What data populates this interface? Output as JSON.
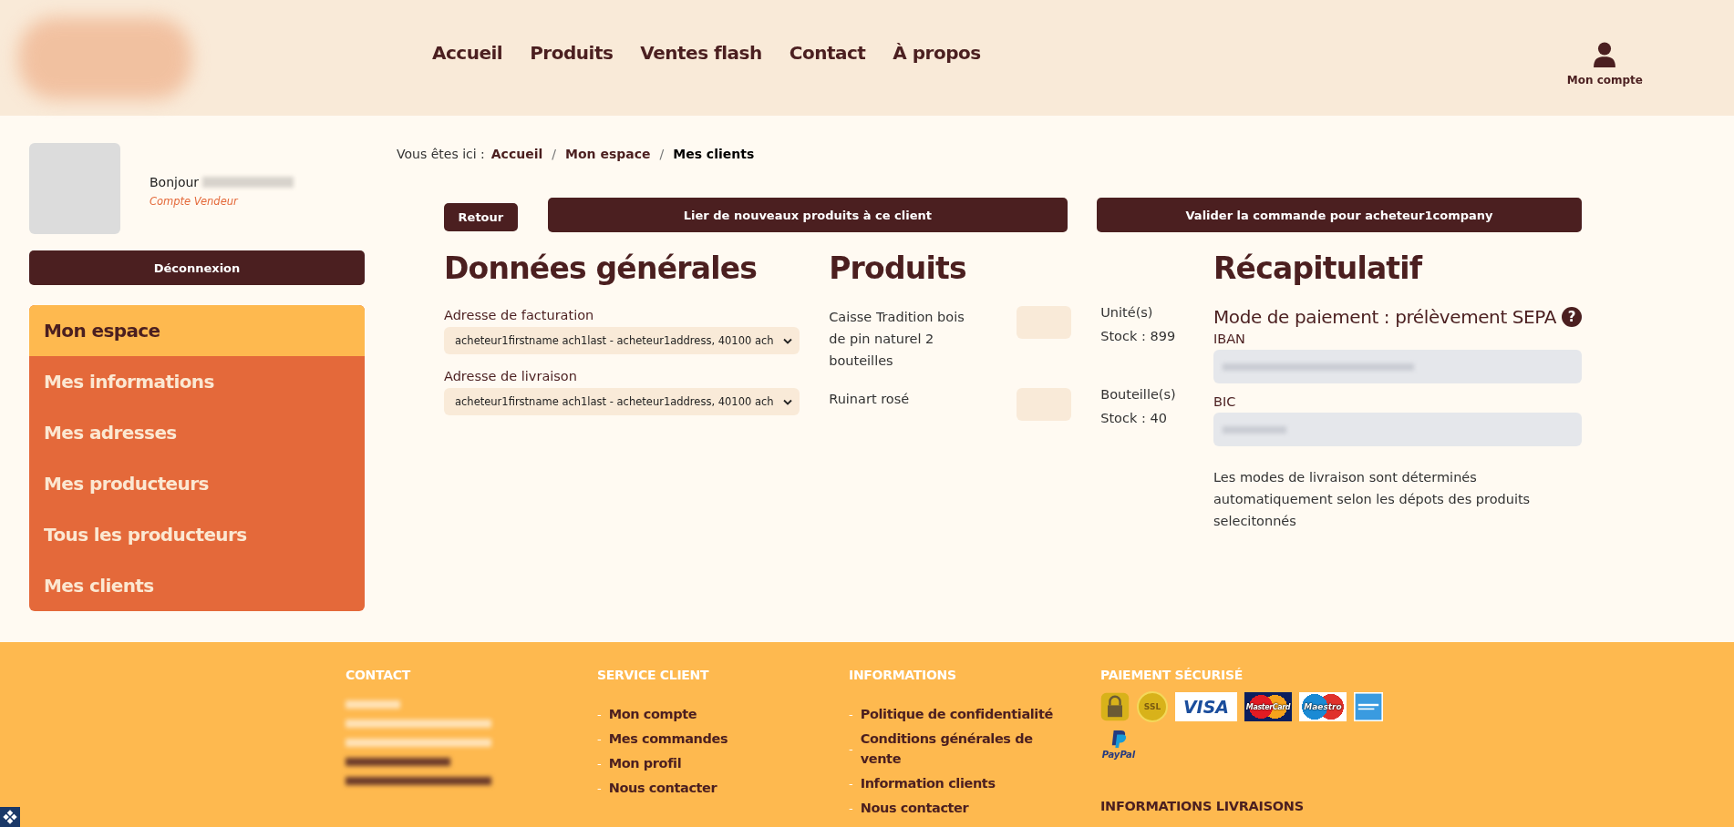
{
  "header": {
    "nav": [
      {
        "label": "Accueil",
        "selected": false
      },
      {
        "label": "Produits",
        "selected": false
      },
      {
        "label": "Ventes flash",
        "selected": false
      },
      {
        "label": "Contact",
        "selected": false
      },
      {
        "label": "À propos",
        "selected": false
      }
    ],
    "account": "Mon compte"
  },
  "user": {
    "greeting": "Bonjour",
    "role": "Compte Vendeur",
    "logout": "Déconnexion"
  },
  "sidebar": {
    "items": [
      {
        "label": "Mon espace",
        "selected": true
      },
      {
        "label": "Mes informations",
        "selected": false
      },
      {
        "label": "Mes adresses",
        "selected": false
      },
      {
        "label": "Mes producteurs",
        "selected": false
      },
      {
        "label": "Tous les producteurs",
        "selected": false
      },
      {
        "label": "Mes clients",
        "selected": false
      }
    ]
  },
  "breadcrumb": {
    "prefix": "Vous êtes ici :",
    "separator": "/",
    "items": [
      {
        "label": "Accueil",
        "selected": false
      },
      {
        "label": "Mon espace",
        "selected": false
      },
      {
        "label": "Mes clients",
        "selected": true
      }
    ]
  },
  "actions": [
    "Retour",
    "Lier de nouveaux produits à ce client",
    "Valider la commande pour acheteur1company"
  ],
  "general": {
    "title": "Données générales",
    "fields": [
      {
        "label": "Adresse de facturation",
        "value": "acheteur1firstname ach1last - acheteur1address, 40100 ach"
      },
      {
        "label": "Adresse de livraison",
        "value": "acheteur1firstname ach1last - acheteur1address, 40100 ach"
      }
    ]
  },
  "products": {
    "title": "Produits",
    "items": [
      {
        "name": "Caisse Tradition bois de pin naturel 2 bouteilles",
        "unit": "Unité(s)",
        "stock": "Stock : 899"
      },
      {
        "name": "Ruinart rosé",
        "unit": "Bouteille(s)",
        "stock": "Stock : 40"
      }
    ]
  },
  "recap": {
    "title": "Récapitulatif",
    "payment": "Mode de paiement : prélèvement SEPA",
    "help": "?",
    "fields": [
      {
        "label": "IBAN"
      },
      {
        "label": "BIC"
      }
    ],
    "note": "Les modes de livraison sont déterminés automatiquement selon les dépots des produits selecitonnés"
  },
  "footer": {
    "contact": {
      "title": "CONTACT"
    },
    "columns": [
      {
        "title": "SERVICE CLIENT",
        "links": [
          "Mon compte",
          "Mes commandes",
          "Mon profil",
          "Nous contacter"
        ]
      },
      {
        "title": "INFORMATIONS",
        "links": [
          "Politique de confidentialité",
          "Conditions générales de vente",
          "Information clients",
          "Nous contacter"
        ]
      }
    ],
    "link_marker": "-",
    "payment": {
      "title": "PAIEMENT SÉCURISÉ",
      "badges": [
        {
          "kind": "lock"
        },
        {
          "kind": "ssl",
          "label": "SSL"
        },
        {
          "kind": "visa",
          "label": "VISA"
        },
        {
          "kind": "mastercard",
          "label": "MasterCard"
        },
        {
          "kind": "maestro",
          "label": "Maestro"
        },
        {
          "kind": "amex"
        },
        {
          "kind": "paypal",
          "label": "PayPal"
        }
      ]
    },
    "delivery_title": "INFORMATIONS LIVRAISONS"
  }
}
